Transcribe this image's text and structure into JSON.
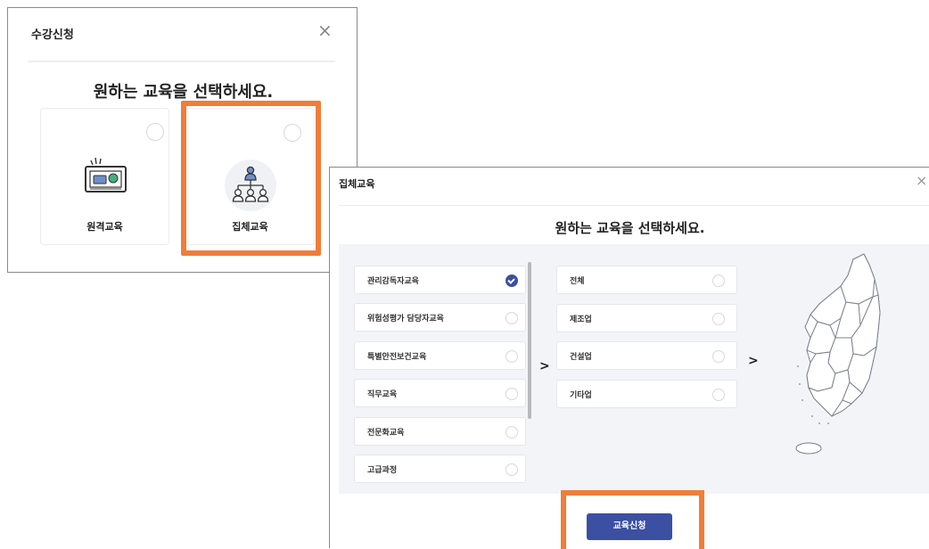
{
  "dialog1": {
    "title": "수강신청",
    "close_icon": "×",
    "heading": "원하는 교육을 선택하세요.",
    "options": [
      {
        "label": "원격교육",
        "icon": "monitor-icon",
        "selected": false
      },
      {
        "label": "집체교육",
        "icon": "people-group-icon",
        "selected": false
      }
    ],
    "highlight_color": "#f07d38"
  },
  "dialog2": {
    "title": "집체교육",
    "close_icon": "×",
    "heading": "원하는 교육을 선택하세요.",
    "categories": [
      {
        "label": "관리감독자교육",
        "selected": true
      },
      {
        "label": "위험성평가 담당자교육",
        "selected": false
      },
      {
        "label": "특별안전보건교육",
        "selected": false
      },
      {
        "label": "직무교육",
        "selected": false
      },
      {
        "label": "전문화교육",
        "selected": false
      },
      {
        "label": "고급과정",
        "selected": false
      }
    ],
    "industries": [
      {
        "label": "전체",
        "selected": false
      },
      {
        "label": "제조업",
        "selected": false
      },
      {
        "label": "건설업",
        "selected": false
      },
      {
        "label": "기타업",
        "selected": false
      }
    ],
    "arrow_glyph": ">",
    "map_icon": "korea-map-icon",
    "apply_button": "교육신청",
    "accent_color": "#3b4fa3",
    "highlight_color": "#f07d38"
  }
}
